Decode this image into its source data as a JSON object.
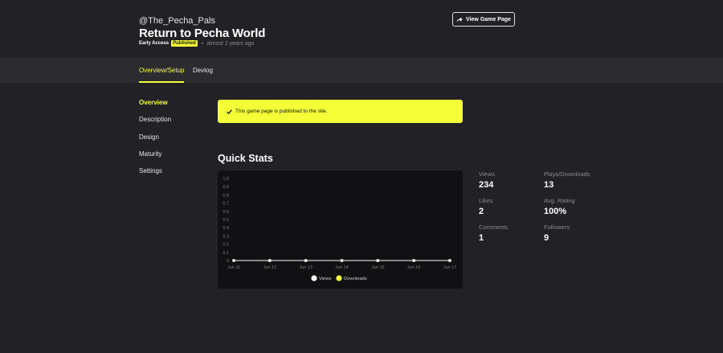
{
  "header": {
    "handle": "@The_Pecha_Pals",
    "title": "Return to Pecha World",
    "badge_early_access": "Early Access",
    "badge_published": "Published",
    "separator": "•",
    "time_ago": "almost 2 years ago",
    "view_button_label": "View Game Page"
  },
  "tabs": [
    {
      "label": "Overview/Setup",
      "active": true
    },
    {
      "label": "Devlog",
      "active": false
    }
  ],
  "sidebar": {
    "items": [
      {
        "label": "Overview",
        "active": true
      },
      {
        "label": "Description",
        "active": false
      },
      {
        "label": "Design",
        "active": false
      },
      {
        "label": "Maturity",
        "active": false
      },
      {
        "label": "Settings",
        "active": false
      }
    ]
  },
  "notice": {
    "text": "This game page is published to the site."
  },
  "quick_stats": {
    "heading": "Quick Stats",
    "stats": [
      {
        "label": "Views",
        "value": "234"
      },
      {
        "label": "Plays/Downloads",
        "value": "13"
      },
      {
        "label": "Likes",
        "value": "2"
      },
      {
        "label": "Avg. Rating",
        "value": "100%"
      },
      {
        "label": "Comments",
        "value": "1"
      },
      {
        "label": "Followers",
        "value": "9"
      }
    ]
  },
  "colors": {
    "accent": "#f4ff38",
    "background": "#222226",
    "tabbar": "#2c2c30",
    "chart_background": "#111113"
  },
  "chart_data": {
    "type": "line",
    "x": [
      "Jun 11",
      "Jun 12",
      "Jun 13",
      "Jun 14",
      "Jun 15",
      "Jun 16",
      "Jun 17"
    ],
    "series": [
      {
        "name": "Views",
        "values": [
          0,
          0,
          0,
          0,
          0,
          0,
          0
        ],
        "color": "#ffffff"
      },
      {
        "name": "Downloads",
        "values": [
          0,
          0,
          0,
          0,
          0,
          0,
          0
        ],
        "color": "#f4ff38"
      }
    ],
    "yticks": [
      "0",
      "0.1",
      "0.2",
      "0.3",
      "0.4",
      "0.5",
      "0.6",
      "0.7",
      "0.8",
      "0.9",
      "1.0"
    ],
    "ylim": [
      0,
      1
    ],
    "grid": false,
    "legend": "bottom"
  }
}
